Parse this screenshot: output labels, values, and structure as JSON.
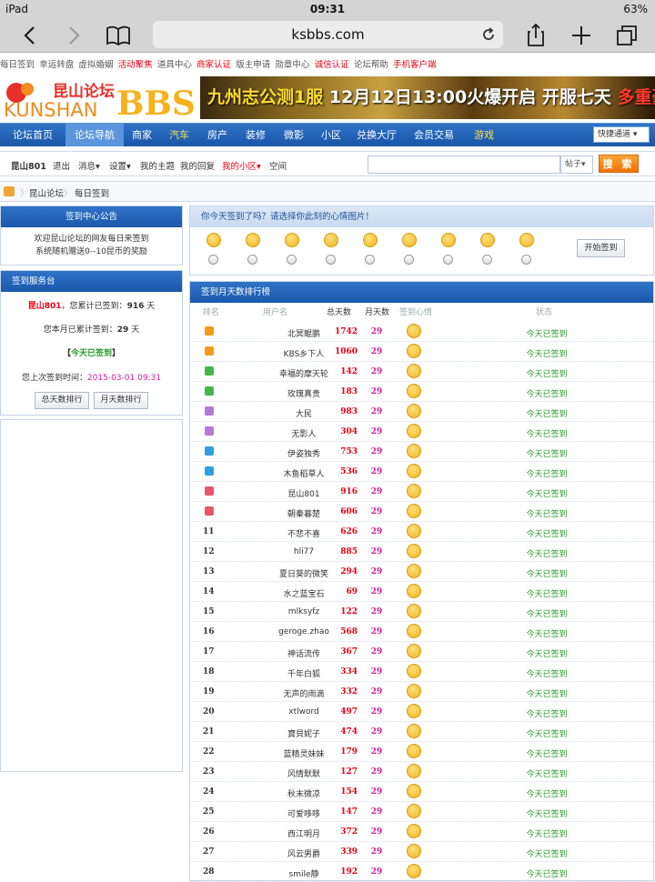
{
  "status": {
    "device": "iPad",
    "time": "09:31",
    "battery": "63%"
  },
  "safari": {
    "url": "ksbbs.com"
  },
  "toplinks": [
    {
      "label": "每日签到",
      "red": false
    },
    {
      "label": "幸运转盘",
      "red": false
    },
    {
      "label": "虚拟婚姻",
      "red": false
    },
    {
      "label": "活动聚焦",
      "red": true
    },
    {
      "label": "道具中心",
      "red": false
    },
    {
      "label": "商家认证",
      "red": true
    },
    {
      "label": "版主申请",
      "red": false
    },
    {
      "label": "勋章中心",
      "red": false
    },
    {
      "label": "诚信认证",
      "red": true
    },
    {
      "label": "论坛帮助",
      "red": false
    },
    {
      "label": "手机客户端",
      "red": true
    }
  ],
  "banner": {
    "logo_cn": "昆山论坛",
    "logo_en": "KUNSHAN",
    "logo_bbs": "BBS",
    "ad_a": "九州志公测1服",
    "ad_b": "12月12日13:00火爆开启",
    "ad_c": "开服七天",
    "ad_d": "多重豪礼送不停"
  },
  "nav": {
    "items": [
      {
        "label": "论坛首页",
        "active": false,
        "yellow": false
      },
      {
        "label": "论坛导航",
        "active": true,
        "yellow": false
      },
      {
        "label": "商家",
        "active": false,
        "yellow": false
      },
      {
        "label": "汽车",
        "active": false,
        "yellow": true
      },
      {
        "label": "房产",
        "active": false,
        "yellow": false
      },
      {
        "label": "装修",
        "active": false,
        "yellow": false
      },
      {
        "label": "微影",
        "active": false,
        "yellow": false
      },
      {
        "label": "小区",
        "active": false,
        "yellow": false
      },
      {
        "label": "兑换大厅",
        "active": false,
        "yellow": false
      },
      {
        "label": "会员交易",
        "active": false,
        "yellow": false
      },
      {
        "label": "游戏",
        "active": false,
        "yellow": true
      }
    ],
    "quick": "快捷通道"
  },
  "userbar": {
    "user": "昆山801",
    "logout": "退出",
    "msg": "消息",
    "settings": "设置",
    "mytopics": "我的主题",
    "myreplies": "我的回复",
    "myarea": "我的小区",
    "space": "空间",
    "search_scope": "帖子",
    "search_btn": "搜 索"
  },
  "crumb": {
    "forum": "昆山论坛",
    "page": "每日签到"
  },
  "notice": {
    "title": "签到中心公告",
    "line1": "欢迎昆山论坛的网友每日来签到",
    "line2": "系统随机赠送0--10昆币的奖励"
  },
  "svc": {
    "title": "签到服务台",
    "user": "昆山801",
    "total_pre": "，您累计已签到：",
    "total": "916",
    "unit": "天",
    "month_pre": "您本月已累计签到：",
    "month": "29",
    "signed": "今天已签到",
    "last_pre": "您上次签到时间：",
    "last": "2015-03-01 09:31",
    "btn_total": "总天数排行",
    "btn_month": "月天数排行"
  },
  "mood": {
    "title": "你今天签到了吗？请选择你此刻的心情图片！",
    "btn": "开始签到",
    "count": 9
  },
  "rank": {
    "title": "签到月天数排行榜",
    "cols": {
      "rank": "排名",
      "name": "用户名",
      "total": "总天数",
      "month": "月天数",
      "mood": "签到心情",
      "status": "状态"
    },
    "rows": [
      {
        "rank": "",
        "name": "北冥鲲鹏",
        "total": "1742",
        "month": "29",
        "status": "今天已签到",
        "icon": "#f39a1e"
      },
      {
        "rank": "",
        "name": "KBS乡下人",
        "total": "1060",
        "month": "29",
        "status": "今天已签到",
        "icon": "#f39a1e"
      },
      {
        "rank": "",
        "name": "幸福的摩天轮",
        "total": "142",
        "month": "29",
        "status": "今天已签到",
        "icon": "#43b649"
      },
      {
        "rank": "",
        "name": "玫瑰真贵",
        "total": "183",
        "month": "29",
        "status": "今天已签到",
        "icon": "#43b649"
      },
      {
        "rank": "",
        "name": "大民",
        "total": "983",
        "month": "29",
        "status": "今天已签到",
        "icon": "#b47ad6"
      },
      {
        "rank": "",
        "name": "无影人",
        "total": "304",
        "month": "29",
        "status": "今天已签到",
        "icon": "#b47ad6"
      },
      {
        "rank": "",
        "name": "伊姿独秀",
        "total": "753",
        "month": "29",
        "status": "今天已签到",
        "icon": "#2f9de0"
      },
      {
        "rank": "",
        "name": "木鱼稻草人",
        "total": "536",
        "month": "29",
        "status": "今天已签到",
        "icon": "#2f9de0"
      },
      {
        "rank": "",
        "name": "昆山801",
        "total": "916",
        "month": "29",
        "status": "今天已签到",
        "icon": "#e5566c"
      },
      {
        "rank": "",
        "name": "朝秦暮楚",
        "total": "606",
        "month": "29",
        "status": "今天已签到",
        "icon": "#e5566c"
      },
      {
        "rank": "11",
        "name": "不悲不喜",
        "total": "626",
        "month": "29",
        "status": "今天已签到",
        "icon": ""
      },
      {
        "rank": "12",
        "name": "hli77",
        "total": "885",
        "month": "29",
        "status": "今天已签到",
        "icon": ""
      },
      {
        "rank": "13",
        "name": "夏日葵的微笑",
        "total": "294",
        "month": "29",
        "status": "今天已签到",
        "icon": ""
      },
      {
        "rank": "14",
        "name": "水之蓝宝石",
        "total": "69",
        "month": "29",
        "status": "今天已签到",
        "icon": ""
      },
      {
        "rank": "15",
        "name": "mlksyfz",
        "total": "122",
        "month": "29",
        "status": "今天已签到",
        "icon": ""
      },
      {
        "rank": "16",
        "name": "geroge.zhao",
        "total": "568",
        "month": "29",
        "status": "今天已签到",
        "icon": ""
      },
      {
        "rank": "17",
        "name": "神话流传",
        "total": "367",
        "month": "29",
        "status": "今天已签到",
        "icon": ""
      },
      {
        "rank": "18",
        "name": "千年白狐",
        "total": "334",
        "month": "29",
        "status": "今天已签到",
        "icon": ""
      },
      {
        "rank": "19",
        "name": "无声的雨滴",
        "total": "332",
        "month": "29",
        "status": "今天已签到",
        "icon": ""
      },
      {
        "rank": "20",
        "name": "xtlword",
        "total": "497",
        "month": "29",
        "status": "今天已签到",
        "icon": ""
      },
      {
        "rank": "21",
        "name": "寶貝妮子",
        "total": "474",
        "month": "29",
        "status": "今天已签到",
        "icon": ""
      },
      {
        "rank": "22",
        "name": "蓝精灵妹妹",
        "total": "179",
        "month": "29",
        "status": "今天已签到",
        "icon": ""
      },
      {
        "rank": "23",
        "name": "风情默默",
        "total": "127",
        "month": "29",
        "status": "今天已签到",
        "icon": ""
      },
      {
        "rank": "24",
        "name": "秋末微凉",
        "total": "154",
        "month": "29",
        "status": "今天已签到",
        "icon": ""
      },
      {
        "rank": "25",
        "name": "可爱哆哆",
        "total": "147",
        "month": "29",
        "status": "今天已签到",
        "icon": ""
      },
      {
        "rank": "26",
        "name": "西江明月",
        "total": "372",
        "month": "29",
        "status": "今天已签到",
        "icon": ""
      },
      {
        "rank": "27",
        "name": "风云男爵",
        "total": "339",
        "month": "29",
        "status": "今天已签到",
        "icon": ""
      },
      {
        "rank": "28",
        "name": "smile静",
        "total": "192",
        "month": "29",
        "status": "今天已签到",
        "icon": ""
      }
    ]
  }
}
